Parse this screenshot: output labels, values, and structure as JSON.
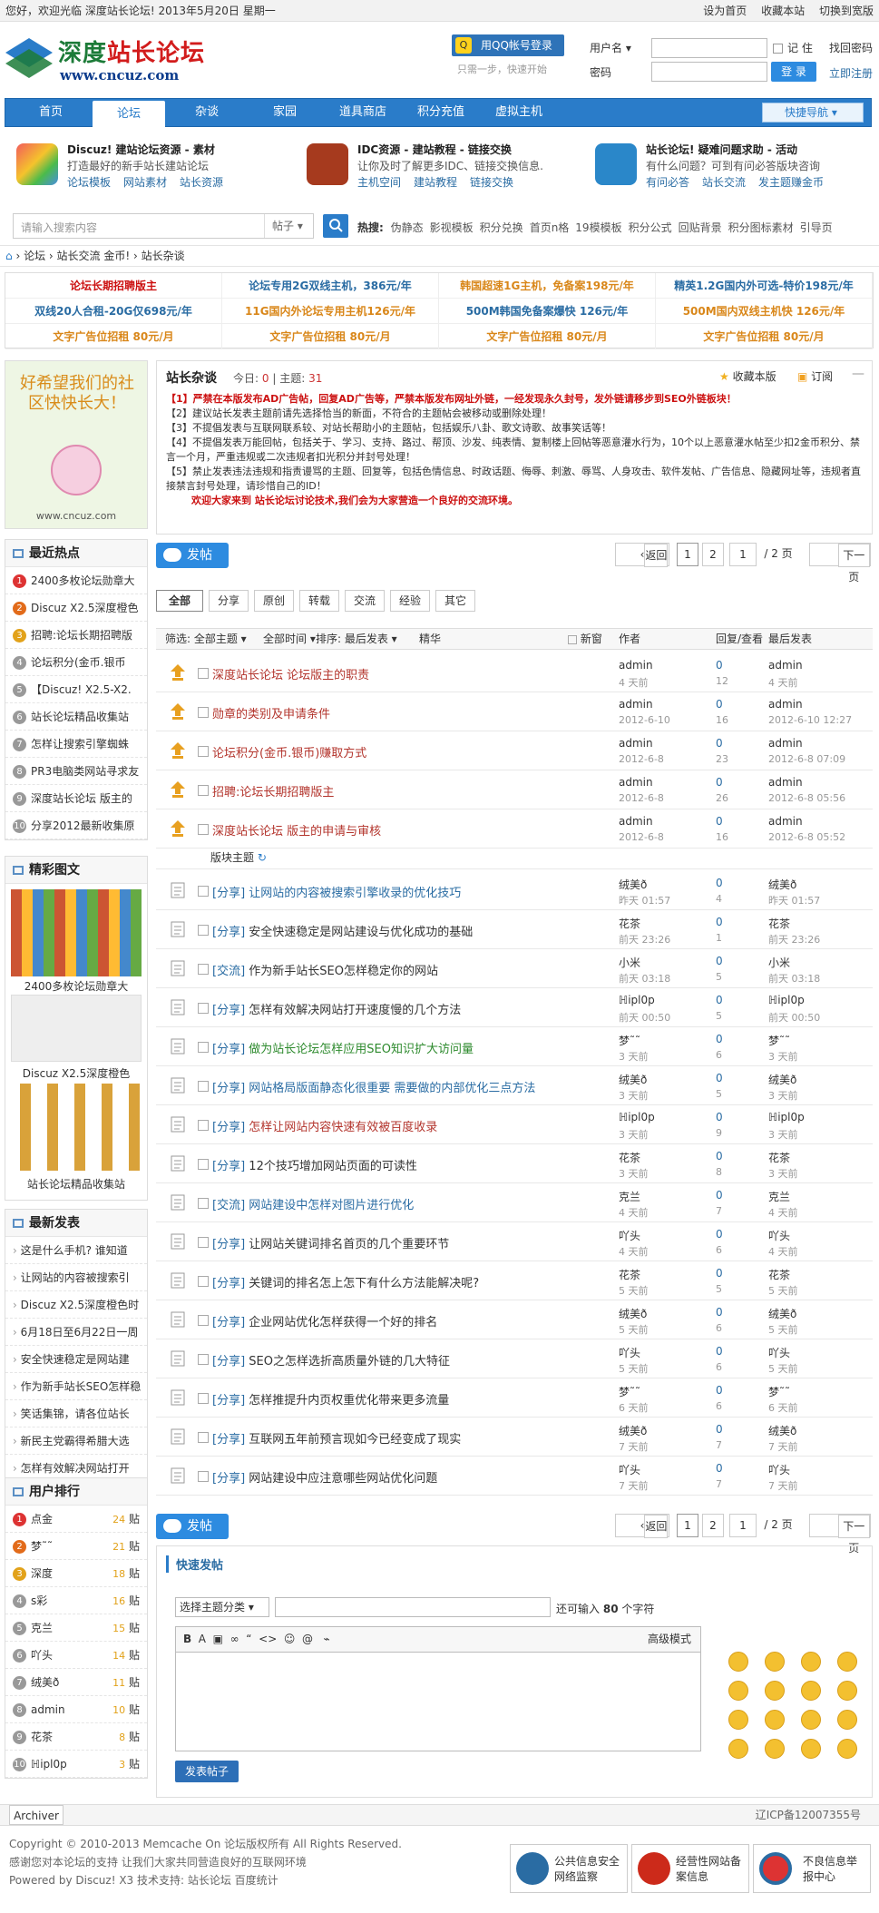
{
  "topbar": {
    "welcome": "您好，欢迎光临 深度站长论坛! 2013年5月20日 星期一",
    "set_home": "设为首页",
    "bookmark": "收藏本站",
    "switch_wide": "切换到宽版"
  },
  "logo": {
    "brand_green": "深度",
    "brand_red": "站长论坛",
    "url": "www.cncuz.com"
  },
  "login": {
    "qq_button": "用QQ帐号登录",
    "qq_sub": "只需一步，快速开始",
    "username_label": "用户名",
    "password_label": "密码",
    "remember": "记 住",
    "forgot": "找回密码",
    "submit": "登 录",
    "register": "立即注册"
  },
  "nav": {
    "items": [
      "首页",
      "论坛",
      "杂谈",
      "家园",
      "道具商店",
      "积分充值",
      "虚拟主机"
    ],
    "active": "论坛",
    "quick": "快捷导航"
  },
  "features": [
    {
      "title": "Discuz! 建站论坛资源 - 素材",
      "desc": "打造最好的新手站长建站论坛",
      "links": [
        "论坛模板",
        "网站素材",
        "站长资源"
      ]
    },
    {
      "title": "IDC资源 - 建站教程 - 链接交换",
      "desc": "让你及时了解更多IDC、链接交换信息.",
      "links": [
        "主机空间",
        "建站教程",
        "链接交换"
      ]
    },
    {
      "title": "站长论坛! 疑难问题求助 - 活动",
      "desc": "有什么问题？可到有问必答版块咨询",
      "links": [
        "有问必答",
        "站长交流",
        "发主题赚金币"
      ]
    }
  ],
  "search": {
    "placeholder": "请输入搜索内容",
    "scope": "帖子"
  },
  "hot": {
    "label": "热搜:",
    "terms": [
      "伪静态",
      "影视模板",
      "积分兑换",
      "首页n格",
      "19模模板",
      "积分公式",
      "回贴背景",
      "积分图标素材",
      "引导页"
    ]
  },
  "breadcrumb": [
    "论坛",
    "站长交流 金币!",
    "站长杂谈"
  ],
  "ads": [
    {
      "text": "论坛长期招聘版主",
      "color": "#cc1111"
    },
    {
      "text": "论坛专用2G双线主机，386元/年",
      "color": "#2a6ca3"
    },
    {
      "text": "韩国超速1G主机，免备案198元/年",
      "color": "#d9871a"
    },
    {
      "text": "精英1.2G国内外可选-特价198元/年",
      "color": "#2a6ca3"
    },
    {
      "text": "双线20人合租-20G仅698元/年",
      "color": "#2a6ca3"
    },
    {
      "text": "11G国内外论坛专用主机126元/年",
      "color": "#d9871a"
    },
    {
      "text": "500M韩国免备案爆快 126元/年",
      "color": "#2a6ca3"
    },
    {
      "text": "500M国内双线主机快 126元/年",
      "color": "#d9871a"
    },
    {
      "text": "文字广告位招租 80元/月",
      "color": "#d9871a"
    },
    {
      "text": "文字广告位招租 80元/月",
      "color": "#d9871a"
    },
    {
      "text": "文字广告位招租 80元/月",
      "color": "#d9871a"
    },
    {
      "text": "文字广告位招租 80元/月",
      "color": "#d9871a"
    }
  ],
  "forum": {
    "name": "站长杂谈",
    "today_label": "今日:",
    "today": "0",
    "threads_label": "主题:",
    "threads": "31",
    "favorite": "收藏本版",
    "subscribe": "订阅",
    "rules": [
      "【1】严禁在本版发布AD广告帖，回复AD广告等，严禁本版发布网址外链，一经发现永久封号，发外链请移步到SEO外链板块！",
      "【2】建议站长发表主题前请先选择恰当的新面，不符合的主题帖会被移动或删除处理！",
      "【3】不提倡发表与互联网联系较、对站长帮助小的主题帖，包括娱乐八卦、歌文诗歌、故事笑话等！",
      "【4】不提倡发表万能回帖，包括关于、学习、支持、路过、帮顶、沙发、纯表情、复制楼上回帖等恶意灌水行为，10个以上恶意灌水帖至少扣2金币积分、禁言一个月，严重违规或二次违规者扣光积分并封号处理！",
      "【5】禁止发表违法违规和指责谩骂的主题、回复等，包括色情信息、时政话题、侮辱、刺激、辱骂、人身攻击、软件发帖、广告信息、隐藏网址等，违规者直接禁言封号处理，请珍惜自己的ID！"
    ],
    "welcome": "欢迎大家来到 站长论坛讨论技术,我们会为大家营造一个良好的交流环境。",
    "mascot_text": "好希望我们的社区快快长大！",
    "mascot_url": "www.cncuz.com"
  },
  "actions": {
    "post": "发帖",
    "back": "返回",
    "page1": "1",
    "page2": "2",
    "page_input": "1",
    "page_total": "/ 2 页",
    "next": "下一页"
  },
  "tabs": [
    "全部",
    "分享",
    "原创",
    "转载",
    "交流",
    "经验",
    "其它"
  ],
  "thead": {
    "filter": "筛选: 全部主题",
    "time": "全部时间",
    "sort": "排序: 最后发表",
    "digest": "精华",
    "new": "新窗",
    "author": "作者",
    "reply_view": "回复/查看",
    "last_post": "最后发表"
  },
  "pinned": [
    {
      "title": "深度站长论坛 论坛版主的职责",
      "author": "admin",
      "date": "4 天前",
      "replies": "0",
      "views": "12",
      "last": "admin",
      "last_date": "4 天前"
    },
    {
      "title": "勋章的类别及申请条件",
      "author": "admin",
      "date": "2012-6-10",
      "replies": "0",
      "views": "16",
      "last": "admin",
      "last_date": "2012-6-10 12:27"
    },
    {
      "title": "论坛积分(金币.银币)赚取方式",
      "author": "admin",
      "date": "2012-6-8",
      "replies": "0",
      "views": "23",
      "last": "admin",
      "last_date": "2012-6-8 07:09"
    },
    {
      "title": "招聘:论坛长期招聘版主",
      "author": "admin",
      "date": "2012-6-8",
      "replies": "0",
      "views": "26",
      "last": "admin",
      "last_date": "2012-6-8 05:56"
    },
    {
      "title": "深度站长论坛 版主的申请与审核",
      "author": "admin",
      "date": "2012-6-8",
      "replies": "0",
      "views": "16",
      "last": "admin",
      "last_date": "2012-6-8 05:52"
    }
  ],
  "section_label": "版块主题",
  "threads": [
    {
      "cat": "[分享]",
      "title": "让网站的内容被搜索引擎收录的优化技巧",
      "style": "cat",
      "author": "绒美ð",
      "date": "昨天 01:57",
      "replies": "0",
      "views": "4",
      "last": "绒美ð",
      "last_date": "昨天 01:57"
    },
    {
      "cat": "[分享]",
      "title": "安全快速稳定是网站建设与优化成功的基础",
      "style": "",
      "author": "花茶",
      "date": "前天 23:26",
      "replies": "0",
      "views": "1",
      "last": "花茶",
      "last_date": "前天 23:26"
    },
    {
      "cat": "[交流]",
      "title": "作为新手站长SEO怎样稳定你的网站",
      "style": "",
      "author": "小米",
      "date": "前天 03:18",
      "replies": "0",
      "views": "5",
      "last": "小米",
      "last_date": "前天 03:18"
    },
    {
      "cat": "[分享]",
      "title": "怎样有效解决网站打开速度慢的几个方法",
      "style": "",
      "author": "ℍipl0p",
      "date": "前天 00:50",
      "replies": "0",
      "views": "5",
      "last": "ℍipl0p",
      "last_date": "前天 00:50"
    },
    {
      "cat": "[分享]",
      "title": "做为站长论坛怎样应用SEO知识扩大访问量",
      "style": "green",
      "author": "梦˜˜",
      "date": "3 天前",
      "replies": "0",
      "views": "6",
      "last": "梦˜˜",
      "last_date": "3 天前"
    },
    {
      "cat": "[分享]",
      "title": "网站格局版面静态化很重要 需要做的内部优化三点方法",
      "style": "cat",
      "author": "绒美ð",
      "date": "3 天前",
      "replies": "0",
      "views": "5",
      "last": "绒美ð",
      "last_date": "3 天前"
    },
    {
      "cat": "[分享]",
      "title": "怎样让网站内容快速有效被百度收录",
      "style": "pinned",
      "author": "ℍipl0p",
      "date": "3 天前",
      "replies": "0",
      "views": "9",
      "last": "ℍipl0p",
      "last_date": "3 天前"
    },
    {
      "cat": "[分享]",
      "title": "12个技巧增加网站页面的可读性",
      "style": "",
      "author": "花茶",
      "date": "3 天前",
      "replies": "0",
      "views": "8",
      "last": "花茶",
      "last_date": "3 天前"
    },
    {
      "cat": "[交流]",
      "title": "网站建设中怎样对图片进行优化",
      "style": "cat",
      "author": "克兰",
      "date": "4 天前",
      "replies": "0",
      "views": "7",
      "last": "克兰",
      "last_date": "4 天前"
    },
    {
      "cat": "[分享]",
      "title": "让网站关键词排名首页的几个重要环节",
      "style": "",
      "author": "吖头",
      "date": "4 天前",
      "replies": "0",
      "views": "6",
      "last": "吖头",
      "last_date": "4 天前"
    },
    {
      "cat": "[分享]",
      "title": "关键词的排名怎上怎下有什么方法能解决呢?",
      "style": "",
      "author": "花茶",
      "date": "5 天前",
      "replies": "0",
      "views": "5",
      "last": "花茶",
      "last_date": "5 天前"
    },
    {
      "cat": "[分享]",
      "title": "企业网站优化怎样获得一个好的排名",
      "style": "",
      "author": "绒美ð",
      "date": "5 天前",
      "replies": "0",
      "views": "6",
      "last": "绒美ð",
      "last_date": "5 天前"
    },
    {
      "cat": "[分享]",
      "title": "SEO之怎样选折高质量外链的几大特征",
      "style": "",
      "author": "吖头",
      "date": "5 天前",
      "replies": "0",
      "views": "6",
      "last": "吖头",
      "last_date": "5 天前"
    },
    {
      "cat": "[分享]",
      "title": "怎样推提升内页权重优化带来更多流量",
      "style": "",
      "author": "梦˜˜",
      "date": "6 天前",
      "replies": "0",
      "views": "6",
      "last": "梦˜˜",
      "last_date": "6 天前"
    },
    {
      "cat": "[分享]",
      "title": "互联网五年前预言现如今已经变成了现实",
      "style": "",
      "author": "绒美ð",
      "date": "7 天前",
      "replies": "0",
      "views": "7",
      "last": "绒美ð",
      "last_date": "7 天前"
    },
    {
      "cat": "[分享]",
      "title": "网站建设中应注意哪些网站优化问题",
      "style": "",
      "author": "吖头",
      "date": "7 天前",
      "replies": "0",
      "views": "7",
      "last": "吖头",
      "last_date": "7 天前"
    }
  ],
  "sidebar": {
    "hot_title": "最近热点",
    "hot": [
      "2400多枚论坛勋章大",
      "Discuz X2.5深度橙色",
      "招聘:论坛长期招聘版",
      "论坛积分(金币.银币",
      "【Discuz! X2.5-X2.",
      "站长论坛精品收集站",
      "怎样让搜索引擎蜘蛛",
      "PR3电脑类网站寻求友",
      "深度站长论坛 版主的",
      "分享2012最新收集原"
    ],
    "pics_title": "精彩图文",
    "pics": [
      "2400多枚论坛勋章大",
      "Discuz X2.5深度橙色",
      "站长论坛精品收集站"
    ],
    "new_title": "最新发表",
    "new": [
      "这是什么手机? 谁知道",
      "让网站的内容被搜索引",
      "Discuz X2.5深度橙色时",
      "6月18日至6月22日一周",
      "安全快速稳定是网站建",
      "作为新手站长SEO怎样稳",
      "笑话集锦，请各位站长",
      "新民主党霸得希腊大选",
      "怎样有效解决网站打开",
      "希腊大选新民主党获胜"
    ],
    "rank_title": "用户排行",
    "rank": [
      {
        "name": "点金",
        "count": "24",
        "unit": "贴"
      },
      {
        "name": "梦˜˜",
        "count": "21",
        "unit": "贴"
      },
      {
        "name": "深度",
        "count": "18",
        "unit": "贴"
      },
      {
        "name": "s彩",
        "count": "16",
        "unit": "贴"
      },
      {
        "name": "克兰",
        "count": "15",
        "unit": "贴"
      },
      {
        "name": "吖头",
        "count": "14",
        "unit": "贴"
      },
      {
        "name": "绒美ð",
        "count": "11",
        "unit": "贴"
      },
      {
        "name": "admin",
        "count": "10",
        "unit": "贴"
      },
      {
        "name": "花茶",
        "count": "8",
        "unit": "贴"
      },
      {
        "name": "ℍipl0p",
        "count": "3",
        "unit": "贴"
      }
    ]
  },
  "quickpost": {
    "title": "快速发帖",
    "category": "选择主题分类",
    "hint_pre": "还可输入",
    "hint_num": "80",
    "hint_post": "个字符",
    "advanced": "高级模式",
    "submit": "发表帖子"
  },
  "footer": {
    "archiver": "Archiver",
    "icp": "辽ICP备12007355号",
    "copyright": "Copyright © 2010-2013 Memcache On 论坛版权所有 All Rights Reserved.",
    "thanks": "感谢您对本论坛的支持 让我们大家共同营造良好的互联网环境",
    "powered": "Powered by Discuz! X3  技术支持: 站长论坛 百度统计",
    "badges": [
      "公共信息安全网络监察",
      "经营性网站备案信息",
      "不良信息举报中心"
    ]
  },
  "colors": {
    "brand_blue": "#2a7cc9",
    "link": "#2a6ca3",
    "red": "#cc1111",
    "orange": "#d9871a",
    "green": "#1c7b38"
  }
}
